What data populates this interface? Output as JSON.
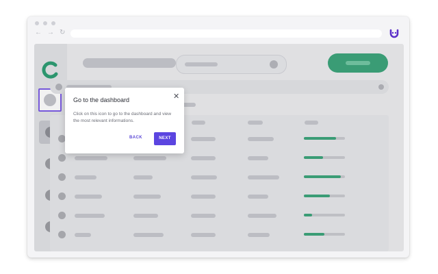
{
  "browser": {
    "nav": {
      "back_icon": "←",
      "forward_icon": "→",
      "reload_icon": "↻"
    }
  },
  "colors": {
    "accent": "#5b45e0",
    "highlight_border": "#7c5ce6",
    "brand_green": "#3ea57c",
    "notification": "#d27280"
  },
  "icons": [
    "browser-extension-icon",
    "app-logo-icon",
    "dashboard-icon",
    "globe-icon",
    "close-icon"
  ],
  "table": {
    "progress": [
      0.78,
      0.46,
      0.9,
      0.64,
      0.2,
      0.5
    ]
  },
  "tooltip": {
    "title": "Go to the dashboard",
    "close": "✕",
    "body": "Click on this icon to go to the dashboard and view the most relevant informations.",
    "back_label": "BACK",
    "next_label": "NEXT"
  }
}
